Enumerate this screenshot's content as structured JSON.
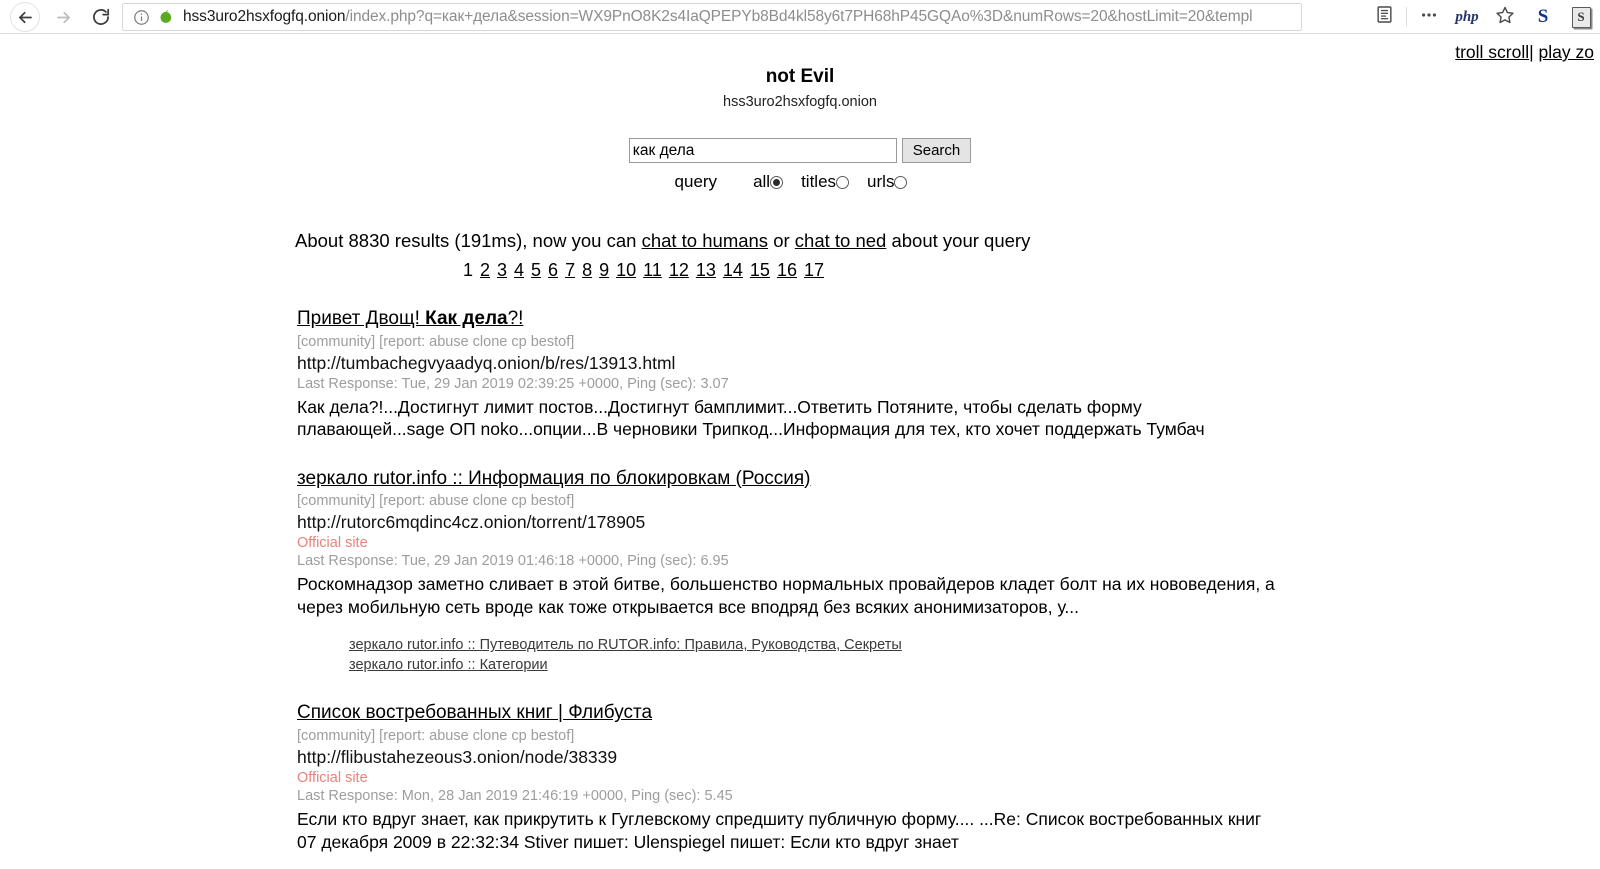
{
  "browser": {
    "url_host": "hss3uro2hsxfogfq.onion",
    "url_path": "/index.php?q=как+дела&session=WX9PnO8K2s4IaQPEPYb8Bd4kl58y6t7PH68hP45GQAo%3D&numRows=20&hostLimit=20&templ",
    "back_label": "Back",
    "forward_label": "Forward",
    "reload_label": "Reload",
    "info_label": "Site information",
    "favicon_label": "onion favicon",
    "toolbar": {
      "reader_label": "Reader view",
      "menu_label": "More",
      "php_label": "php",
      "bookmark_label": "Bookmark this page",
      "s_blue_label": "S",
      "s_badge_label": "S"
    }
  },
  "corner": {
    "troll_scroll": "troll scroll",
    "separator": "|",
    "play_zone": "play zo"
  },
  "header": {
    "title": "not Evil",
    "subtitle": "hss3uro2hsxfogfq.onion"
  },
  "search": {
    "value": "как дела",
    "placeholder": "",
    "button": "Search",
    "query_label": "query",
    "options": [
      {
        "label": "all",
        "checked": true
      },
      {
        "label": "titles",
        "checked": false
      },
      {
        "label": "urls",
        "checked": false
      }
    ]
  },
  "results_info": {
    "prefix": "About 8830 results (191ms), now you can ",
    "link1": "chat to humans",
    "middle": " or ",
    "link2": "chat to ned",
    "suffix": " about your query"
  },
  "pagination": {
    "current": "1",
    "pages": [
      "2",
      "3",
      "4",
      "5",
      "6",
      "7",
      "8",
      "9",
      "10",
      "11",
      "12",
      "13",
      "14",
      "15",
      "16",
      "17"
    ]
  },
  "results": [
    {
      "title_prefix": "Привет Двощ! ",
      "title_bold": "Как дела",
      "title_suffix": "?!",
      "tags": "[community] [report: abuse clone cp bestof]",
      "url": "http://tumbachegvyaadyq.onion/b/res/13913.html",
      "official": "",
      "meta": "Last Response: Tue, 29 Jan 2019 02:39:25 +0000, Ping (sec): 3.07",
      "snippet": "Как дела?!...Достигнут лимит постов...Достигнут бамплимит...Ответить Потяните, чтобы сделать форму плавающей...sage ОП noko...опции...В черновики Трипкод...Информация для тех, кто хочет поддержать Тумбач",
      "sublinks": []
    },
    {
      "title_prefix": "зеркало rutor.info :: Информация по блокировкам (Россия)",
      "title_bold": "",
      "title_suffix": "",
      "tags": "[community] [report: abuse clone cp bestof]",
      "url": "http://rutorc6mqdinc4cz.onion/torrent/178905",
      "official": "Official site",
      "meta": "Last Response: Tue, 29 Jan 2019 01:46:18 +0000, Ping (sec): 6.95",
      "snippet": "Роскомнадзор заметно сливает в этой битве, большенство нормальных провайдеров кладет болт на их нововедения, а через мобильную сеть вроде как тоже открывается все вподряд без всяких анонимизаторов, у...",
      "sublinks": [
        "зеркало rutor.info :: Путеводитель по RUTOR.info: Правила, Руководства, Секреты",
        "зеркало rutor.info :: Категории"
      ]
    },
    {
      "title_prefix": "Список востребованных книг | Флибуста",
      "title_bold": "",
      "title_suffix": "",
      "tags": "[community] [report: abuse clone cp bestof]",
      "url": "http://flibustahezeous3.onion/node/38339",
      "official": "Official site",
      "meta": "Last Response: Mon, 28 Jan 2019 21:46:19 +0000, Ping (sec): 5.45",
      "snippet": "Если кто вдруг знает, как прикрутить к Гуглевскому спредшиту публичную форму.... ...Re: Список востребованных книг  07 декабря 2009  в 22:32:34 Stiver пишет:   Ulenspiegel пишет:   Если кто вдруг знает",
      "sublinks": []
    }
  ],
  "colors": {
    "official_site": "#e8837a",
    "meta_grey": "#9d9d9d",
    "link_black": "#000000",
    "favicon_green": "#5aa91e"
  }
}
